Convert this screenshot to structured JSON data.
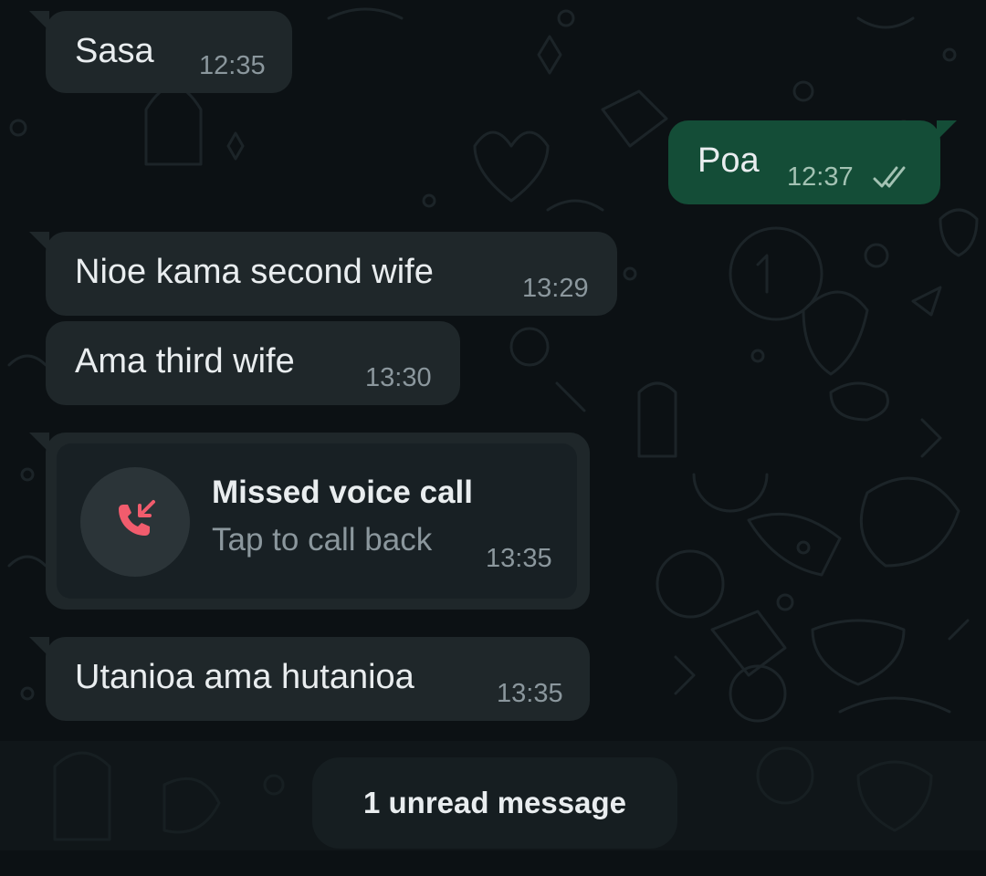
{
  "colors": {
    "background": "#0c1114",
    "incoming_bubble": "#1f272a",
    "outgoing_bubble": "#144d37",
    "timestamp": "#8b979d",
    "missed_call_icon": "#f15c6d",
    "read_ticks": "#a3c2b3"
  },
  "messages": [
    {
      "direction": "incoming",
      "text": "Sasa",
      "time": "12:35"
    },
    {
      "direction": "outgoing",
      "text": "Poa",
      "time": "12:37",
      "status_icon": "double-check-icon"
    },
    {
      "direction": "incoming",
      "text": "Nioe kama second wife",
      "time": "13:29"
    },
    {
      "direction": "incoming",
      "text": "Ama third wife",
      "time": "13:30"
    },
    {
      "direction": "incoming",
      "type": "missed-call",
      "title": "Missed voice call",
      "subtitle": "Tap to call back",
      "time": "13:35",
      "icon": "missed-call-icon"
    },
    {
      "direction": "incoming",
      "text": "Utanioa ama hutanioa",
      "time": "13:35"
    }
  ],
  "unread_banner": {
    "text": "1 unread message"
  }
}
